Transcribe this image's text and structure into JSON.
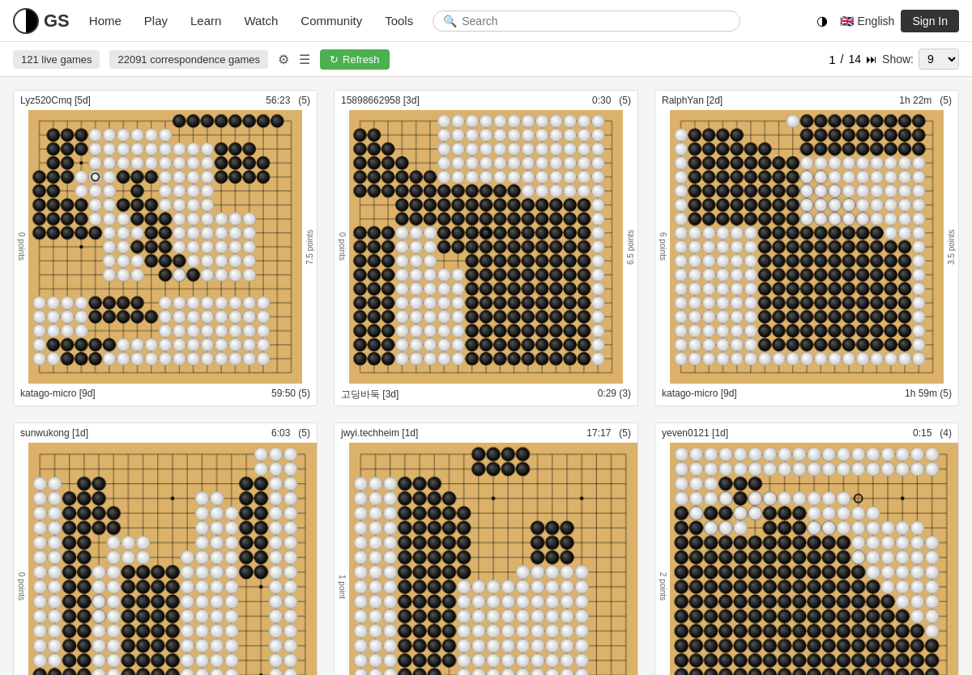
{
  "header": {
    "logo_text": "GS",
    "nav": [
      "Home",
      "Play",
      "Learn",
      "Watch",
      "Community",
      "Tools"
    ],
    "search_placeholder": "Search",
    "language": "English",
    "sign_in": "Sign In"
  },
  "toolbar": {
    "live_games": "121 live games",
    "correspondence_games": "22091 correspondence games",
    "refresh": "Refresh",
    "page_current": "1",
    "page_separator": "/",
    "page_total": "14",
    "show_label": "Show:",
    "show_value": "9"
  },
  "games": [
    {
      "top_player": "Lyz520Cmq [5d]",
      "top_time": "56:23",
      "top_byo": "(5)",
      "bottom_player": "katago-micro [9d]",
      "bottom_time": "59:50",
      "bottom_byo": "(5)",
      "left_label": "0 points",
      "right_label": "7.5 points",
      "board_id": "board1"
    },
    {
      "top_player": "15898662958 [3d]",
      "top_time": "0:30",
      "top_byo": "(5)",
      "bottom_player": "고딩바둑 [3d]",
      "bottom_time": "0:29",
      "bottom_byo": "(3)",
      "left_label": "0 points",
      "right_label": "6.5 points",
      "board_id": "board2"
    },
    {
      "top_player": "RalphYan [2d]",
      "top_time": "1h 22m",
      "top_byo": "(5)",
      "bottom_player": "katago-micro [9d]",
      "bottom_time": "1h 59m",
      "bottom_byo": "(5)",
      "left_label": "6 points",
      "right_label": "3.5 points",
      "board_id": "board3"
    },
    {
      "top_player": "sunwukong [1d]",
      "top_time": "6:03",
      "top_byo": "(5)",
      "bottom_player": "",
      "bottom_time": "",
      "bottom_byo": "",
      "left_label": "0 points",
      "right_label": "",
      "board_id": "board4"
    },
    {
      "top_player": "jwyi.techheim [1d]",
      "top_time": "17:17",
      "top_byo": "(5)",
      "bottom_player": "",
      "bottom_time": "",
      "bottom_byo": "",
      "left_label": "1 point",
      "right_label": "",
      "board_id": "board5"
    },
    {
      "top_player": "yeven0121 [1d]",
      "top_time": "0:15",
      "top_byo": "(4)",
      "bottom_player": "",
      "bottom_time": "",
      "bottom_byo": "",
      "left_label": "2 points",
      "right_label": "",
      "board_id": "board6"
    }
  ]
}
